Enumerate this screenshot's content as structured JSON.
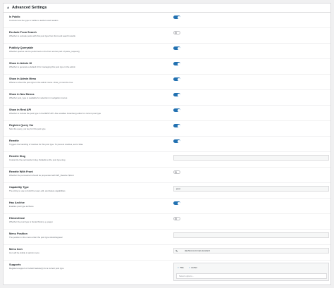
{
  "panel": {
    "title": "Advanced Settings"
  },
  "rows": [
    {
      "label": "Is Public",
      "desc": "Controls how the type is visible to authors and readers",
      "control": "toggle",
      "on": true
    },
    {
      "label": "Exclude From Search",
      "desc": "Whether to exclude posts with this post type from front end search results",
      "control": "toggle",
      "on": false
    },
    {
      "label": "Publicly Queryable",
      "desc": "Whether queries can be performed on the front end as part of parse_request()",
      "control": "toggle",
      "on": true
    },
    {
      "label": "Show in Admin UI",
      "desc": "Whether to generate a default UI for managing this post type in the admin",
      "control": "toggle",
      "on": true
    },
    {
      "label": "Show in Admin Menu",
      "desc": "Where to show the post type in the admin menu. show_ui must be true",
      "control": "toggle",
      "on": true
    },
    {
      "label": "Show in Nav Menus",
      "desc": "Whether post_type is available for selection in navigation menus",
      "control": "toggle",
      "on": true
    },
    {
      "label": "Show in Rest API",
      "desc": "Whether to include the post type in the REST API. Also enables Gutenberg editor for current post type",
      "control": "toggle",
      "on": true
    },
    {
      "label": "Register Query Var",
      "desc": "Sets the query_var key for this post type",
      "control": "toggle",
      "on": true
    },
    {
      "label": "Rewrite",
      "desc": "Triggers the handling of rewrites for this post type. To prevent rewrites, set to false",
      "control": "toggle",
      "on": true
    },
    {
      "label": "Rewrite Slug",
      "desc": "Customize the permastruct slug. Defaults to the post type slug",
      "control": "text",
      "value": ""
    },
    {
      "label": "Rewrite With Front",
      "desc": "Whether the permastruct should be prepended with WP_Rewrite::$front",
      "control": "toggle",
      "on": false
    },
    {
      "label": "Capability Type",
      "desc": "The string to use to build the read, edit, and delete capabilities",
      "control": "text",
      "value": "post"
    },
    {
      "label": "Has Archive",
      "desc": "Enables post type archives",
      "control": "toggle",
      "on": true
    },
    {
      "label": "Hierarchical",
      "desc": "Whether the post type is hierarchical (e.g. page)",
      "control": "toggle",
      "on": false
    },
    {
      "label": "Menu Position",
      "desc": "The position in the menu order the post type should appear",
      "control": "text",
      "value": ""
    },
    {
      "label": "Menu Icon",
      "desc": "Icon will be visible in admin menu",
      "control": "icon",
      "value": "dashicons-format-standard"
    },
    {
      "label": "Supports",
      "desc": "Registers support of certain feature(s) for a current post type",
      "control": "supports",
      "tags": [
        {
          "label": "Title",
          "remove": "×"
        },
        {
          "label": "Author",
          "remove": "×"
        }
      ],
      "placeholder": "Select options..."
    }
  ],
  "icons": {
    "caret": "caret-up-icon",
    "menu_icon": "pin-icon"
  },
  "colors": {
    "accent": "#2271b1",
    "border": "#dcdcde",
    "background": "#f0f0f1"
  }
}
